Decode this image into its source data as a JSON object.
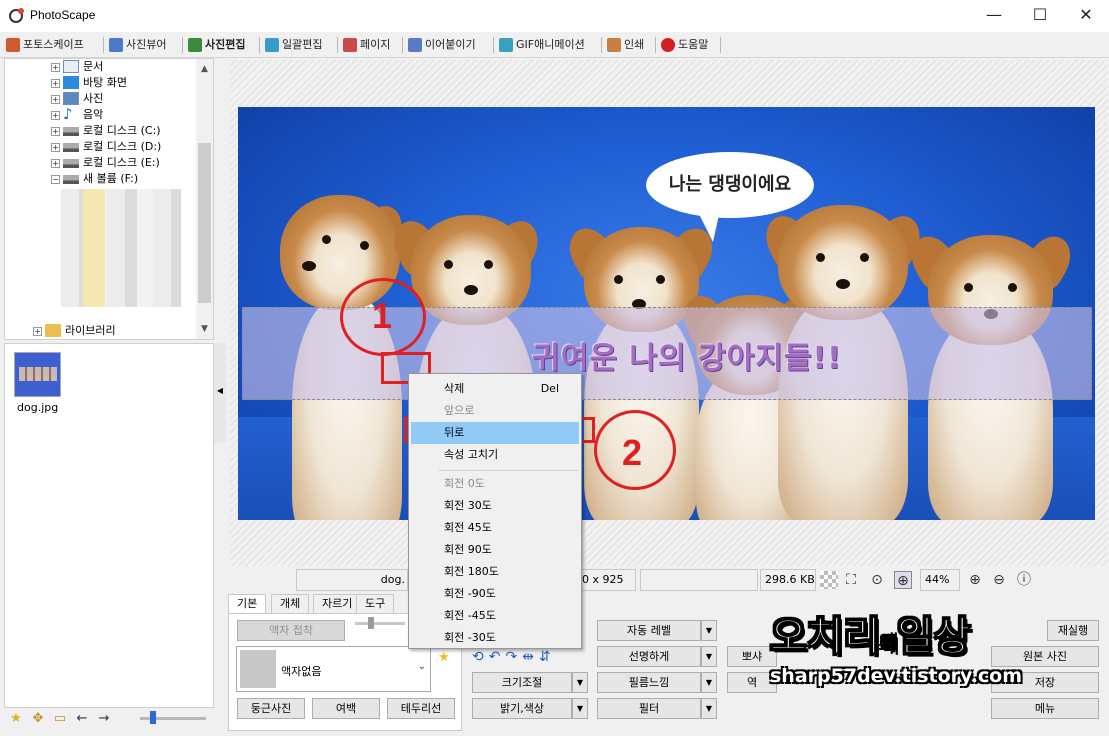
{
  "window": {
    "title": "PhotoScape",
    "minimize": "—",
    "maximize": "☐",
    "close": "✕"
  },
  "tabs": [
    {
      "label": "포토스케이프",
      "icon": "photoscape-icon",
      "color": "#d05a30"
    },
    {
      "label": "사진뷰어",
      "icon": "viewer-icon",
      "color": "#4a7ac8"
    },
    {
      "label": "사진편집",
      "icon": "editor-icon",
      "color": "#3a8a3a"
    },
    {
      "label": "일괄편집",
      "icon": "batch-icon",
      "color": "#3a9ad0"
    },
    {
      "label": "페이지",
      "icon": "page-icon",
      "color": "#c84a4a"
    },
    {
      "label": "이어붙이기",
      "icon": "combine-icon",
      "color": "#5a7ac8"
    },
    {
      "label": "GIF애니메이션",
      "icon": "gif-icon",
      "color": "#3aa0c0"
    },
    {
      "label": "인쇄",
      "icon": "print-icon",
      "color": "#c88040"
    },
    {
      "label": "도움말",
      "icon": "help-icon",
      "color": "#d02020"
    }
  ],
  "tree": {
    "items": [
      {
        "label": "문서",
        "icon": "document-icon"
      },
      {
        "label": "바탕 화면",
        "icon": "desktop-icon"
      },
      {
        "label": "사진",
        "icon": "pictures-icon"
      },
      {
        "label": "음악",
        "icon": "music-icon"
      },
      {
        "label": "로컬 디스크 (C:)",
        "icon": "drive-icon"
      },
      {
        "label": "로컬 디스크 (D:)",
        "icon": "drive-icon"
      },
      {
        "label": "로컬 디스크 (E:)",
        "icon": "drive-icon"
      },
      {
        "label": "새 볼륨 (F:)",
        "icon": "drive-icon"
      }
    ],
    "partial_item": "라이브러리"
  },
  "files": [
    {
      "name": "dog.jpg"
    }
  ],
  "canvas": {
    "speech_bubble": "나는 댕댕이에요",
    "banner_text": "귀여운 나의 강아지들!!"
  },
  "annotations": {
    "step1": "1",
    "step2": "2"
  },
  "context_menu": {
    "items": [
      {
        "label": "삭제",
        "shortcut": "Del",
        "disabled": false
      },
      {
        "label": "앞으로",
        "shortcut": "",
        "disabled": true
      },
      {
        "label": "뒤로",
        "shortcut": "",
        "disabled": false,
        "highlighted": true
      },
      {
        "label": "속성 고치기",
        "shortcut": "",
        "disabled": false
      },
      {
        "label": "회전 0도",
        "shortcut": "",
        "disabled": true
      },
      {
        "label": "회전 30도",
        "shortcut": "",
        "disabled": false
      },
      {
        "label": "회전 45도",
        "shortcut": "",
        "disabled": false
      },
      {
        "label": "회전 90도",
        "shortcut": "",
        "disabled": false
      },
      {
        "label": "회전 180도",
        "shortcut": "",
        "disabled": false
      },
      {
        "label": "회전 -90도",
        "shortcut": "",
        "disabled": false
      },
      {
        "label": "회전 -45도",
        "shortcut": "",
        "disabled": false
      },
      {
        "label": "회전 -30도",
        "shortcut": "",
        "disabled": false
      }
    ]
  },
  "status": {
    "filename": "dog.",
    "dimensions": "0 x 925",
    "filesize": "298.6 KB",
    "zoom": "44%"
  },
  "tool_tabs": [
    "기본",
    "개체",
    "자르기",
    "도구"
  ],
  "tools": {
    "frame_attach": "액자 접착",
    "frame_none": "액자없음",
    "round_photo": "둥근사진",
    "margin": "여백",
    "border_line": "테두리선",
    "resize": "크기조절",
    "brightness": "밝기,색상",
    "auto_level": "자동 레벨",
    "sharpen": "선명하게",
    "film_effect": "필름느낌",
    "filter": "필터",
    "partial_1": "뽀샤",
    "partial_2": "역",
    "redo": "재실행",
    "original": "원본 사진",
    "save": "저장",
    "menu": "메뉴"
  },
  "watermark": {
    "title_part1": "오치리",
    "title_small": "의",
    "title_part2": "일상",
    "url": "sharp57dev.tistory.com"
  }
}
